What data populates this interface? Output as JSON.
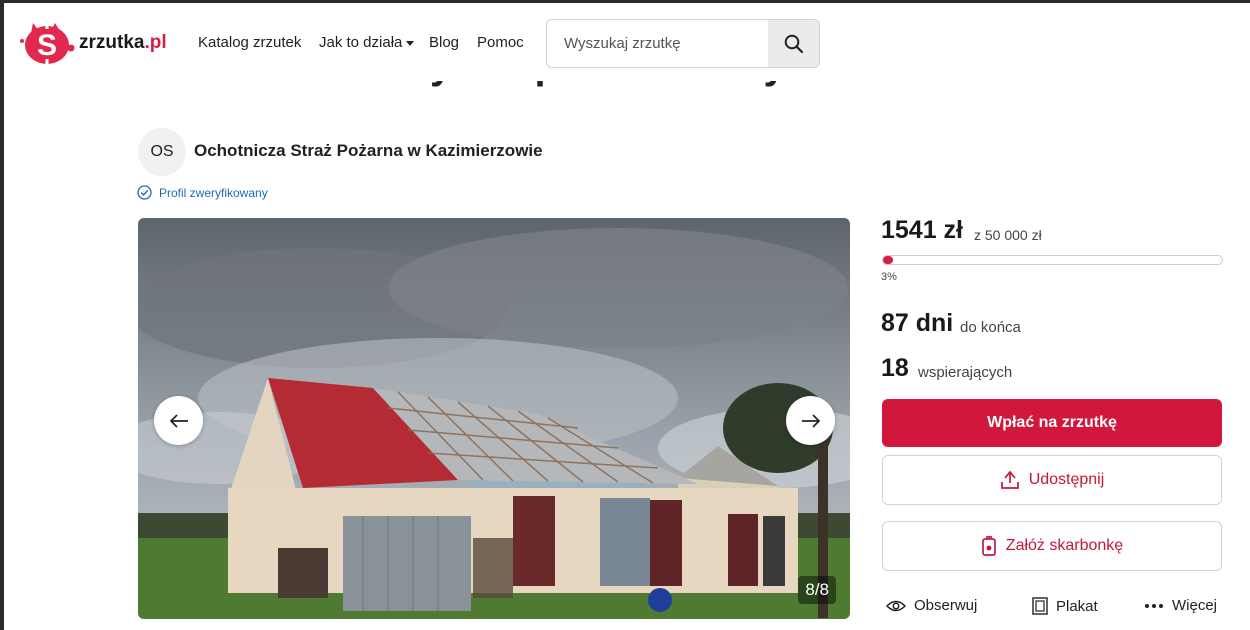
{
  "brand": {
    "name": "zrzutka",
    "tld": ".pl",
    "color": "#d21f4a"
  },
  "nav": {
    "catalog": "Katalog zrzutek",
    "how": "Jak to działa",
    "blog": "Blog",
    "help": "Pomoc"
  },
  "search": {
    "placeholder": "Wyszukaj zrzutkę",
    "icon": "search-icon"
  },
  "fundraiser": {
    "title_visible": "Odbudowa budynku po nawałnicy",
    "organizer_initials": "OS",
    "organizer_name": "Ochotnicza Straż Pożarna w Kazimierzowie",
    "verified_label": "Profil zweryfikowany"
  },
  "gallery": {
    "counter": "8/8",
    "prev_icon": "arrow-left-icon",
    "next_icon": "arrow-right-icon"
  },
  "stats": {
    "amount": "1541 zł",
    "goal": "z 50 000 zł",
    "progress_percent": 3,
    "progress_label": "3%",
    "days": "87 dni",
    "days_label": "do końca",
    "supporters": "18",
    "supporters_label": "wspierających"
  },
  "buttons": {
    "donate": "Wpłać na zrzutkę",
    "share": "Udostępnij",
    "piggybank": "Załóż skarbonkę"
  },
  "actions": {
    "follow": "Obserwuj",
    "poster": "Plakat",
    "more": "Więcej"
  },
  "colors": {
    "accent": "#d2173d",
    "link": "#1b6ab3"
  }
}
